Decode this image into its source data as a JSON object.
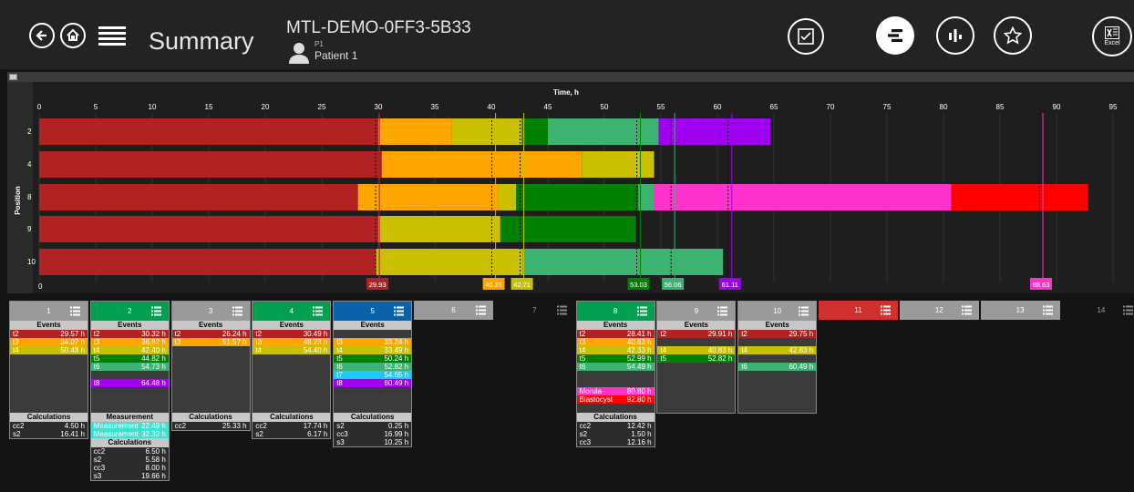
{
  "header": {
    "title": "Summary",
    "embryo_id": "MTL-DEMO-0FF3-5B33",
    "patient_code": "P1",
    "patient_name": "Patient 1",
    "excel_label": "Excel"
  },
  "icons": {
    "back": "back-arrow-icon",
    "home": "home-icon",
    "menu": "hamburger-menu-icon",
    "checklist": "checkbox-icon",
    "timeline": "timeline-bars-icon",
    "compare": "compare-chart-icon",
    "favorite": "star-icon",
    "excel": "excel-export-icon",
    "patient": "person-icon",
    "list": "list-icon"
  },
  "colors": {
    "t2": "#b22222",
    "t3": "#ffa500",
    "t4": "#c8c000",
    "t5": "#008000",
    "t6": "#3cb371",
    "t7": "#1ec8ff",
    "t8": "#a000f0",
    "morula": "#ff33cc",
    "blastocyst": "#ff0000",
    "measurement": "#40e0d0",
    "green_hdr": "#00a050",
    "blue_hdr": "#0a63a8",
    "red_hdr": "#d03030",
    "gray_hdr": "#9a9a9a"
  },
  "chart_data": {
    "type": "gantt",
    "xlabel": "Time, h",
    "ylabel": "Position",
    "xlim": [
      0,
      95
    ],
    "xticks": [
      0,
      5,
      10,
      15,
      20,
      25,
      30,
      35,
      40,
      45,
      50,
      55,
      60,
      65,
      70,
      75,
      80,
      85,
      90,
      95
    ],
    "rows": [
      {
        "position": "2",
        "segments": [
          [
            "t2",
            0,
            30
          ],
          [
            "t3",
            30,
            36.5
          ],
          [
            "t4",
            36.5,
            42.7
          ],
          [
            "t5",
            42.7,
            45
          ],
          [
            "t6",
            45,
            54.8
          ],
          [
            "t8",
            54.8,
            64.7
          ]
        ]
      },
      {
        "position": "4",
        "segments": [
          [
            "t2",
            0,
            30.3
          ],
          [
            "t3",
            30.3,
            48
          ],
          [
            "t4",
            48,
            54.4
          ]
        ]
      },
      {
        "position": "8",
        "segments": [
          [
            "t2",
            0,
            28.2
          ],
          [
            "t3",
            28.2,
            40.6
          ],
          [
            "t4",
            40.6,
            42.2
          ],
          [
            "t5",
            42.2,
            53
          ],
          [
            "t6",
            53,
            54.4
          ],
          [
            "morula",
            54.4,
            80.7
          ],
          [
            "blastocyst",
            80.7,
            92.8
          ]
        ]
      },
      {
        "position": "9",
        "segments": [
          [
            "t2",
            0,
            30
          ],
          [
            "t4",
            30,
            40.8
          ],
          [
            "t5",
            40.8,
            52.8
          ]
        ]
      },
      {
        "position": "10",
        "segments": [
          [
            "t2",
            0,
            29.8
          ],
          [
            "t4",
            29.8,
            42.8
          ],
          [
            "t6",
            42.8,
            60.5
          ]
        ]
      }
    ],
    "markers": [
      {
        "label": "29.93",
        "x": 29.93,
        "color": "#b22222"
      },
      {
        "label": "40.21",
        "x": 40.21,
        "color": "#ffa500"
      },
      {
        "label": "42.71",
        "x": 42.71,
        "color": "#c8c000"
      },
      {
        "label": "53.03",
        "x": 53.03,
        "color": "#008000"
      },
      {
        "label": "56.06",
        "x": 56.06,
        "color": "#3cb371"
      },
      {
        "label": "61.11",
        "x": 61.11,
        "color": "#a000f0"
      },
      {
        "label": "88.63",
        "x": 88.63,
        "color": "#ff33cc"
      }
    ]
  },
  "cards": [
    {
      "num": "1",
      "hdr": "gray_hdr",
      "events": [
        [
          "t2",
          "29.57 h",
          "t2"
        ],
        [
          "t3",
          "34.07 h",
          "t3"
        ],
        [
          "t4",
          "50.48 h",
          "t4"
        ]
      ],
      "calc_title": "Calculations",
      "calcs": [
        [
          "cc2",
          "4.50 h"
        ],
        [
          "s2",
          "16.41 h"
        ]
      ]
    },
    {
      "num": "2",
      "hdr": "green_hdr",
      "events": [
        [
          "t2",
          "30.32 h",
          "t2"
        ],
        [
          "t3",
          "36.82 h",
          "t3"
        ],
        [
          "t4",
          "42.40 h",
          "t4"
        ],
        [
          "t5",
          "44.82 h",
          "t5"
        ],
        [
          "t6",
          "54.73 h",
          "t6"
        ],
        [
          "",
          "",
          ""
        ],
        [
          "t8",
          "64.48 h",
          "t8"
        ]
      ],
      "meas_title": "Measurement",
      "meas": [
        [
          "Measurement",
          "22.49 h"
        ],
        [
          "Measurement",
          "32.32 h"
        ]
      ],
      "calc_title": "Calculations",
      "calcs": [
        [
          "cc2",
          "6.50 h"
        ],
        [
          "s2",
          "5.58 h"
        ],
        [
          "cc3",
          "8.00 h"
        ],
        [
          "s3",
          "19.66 h"
        ]
      ]
    },
    {
      "num": "3",
      "hdr": "gray_hdr",
      "events": [
        [
          "t2",
          "26.24 h",
          "t2"
        ],
        [
          "t3",
          "51.57 h",
          "t3"
        ]
      ],
      "calc_title": "Calculations",
      "calcs": [
        [
          "cc2",
          "25.33 h"
        ]
      ]
    },
    {
      "num": "4",
      "hdr": "green_hdr",
      "events": [
        [
          "t2",
          "30.49 h",
          "t2"
        ],
        [
          "t3",
          "48.23 h",
          "t3"
        ],
        [
          "t4",
          "54.40 h",
          "t4"
        ]
      ],
      "calc_title": "Calculations",
      "calcs": [
        [
          "cc2",
          "17.74 h"
        ],
        [
          "s2",
          "6.17 h"
        ]
      ]
    },
    {
      "num": "5",
      "hdr": "blue_hdr",
      "events": [
        [
          "",
          "",
          ""
        ],
        [
          "t3",
          "33.24 h",
          "t3"
        ],
        [
          "t4",
          "33.49 h",
          "t4"
        ],
        [
          "t5",
          "50.24 h",
          "t5"
        ],
        [
          "t6",
          "52.82 h",
          "t6"
        ],
        [
          "t7",
          "54.65 h",
          "t7"
        ],
        [
          "t8",
          "60.49 h",
          "t8"
        ]
      ],
      "calc_title": "Calculations",
      "calcs": [
        [
          "s2",
          "0.25 h"
        ],
        [
          "cc3",
          "16.99 h"
        ],
        [
          "s3",
          "10.25 h"
        ]
      ]
    },
    {
      "num": "6",
      "hdr": "gray_hdr",
      "plain": true
    },
    {
      "num": "7",
      "hdr": "dark",
      "plain": true
    },
    {
      "num": "8",
      "hdr": "green_hdr",
      "events": [
        [
          "t2",
          "28.41 h",
          "t2"
        ],
        [
          "t3",
          "40.63 h",
          "t3"
        ],
        [
          "t4",
          "42.33 h",
          "t4"
        ],
        [
          "t5",
          "52.99 h",
          "t5"
        ],
        [
          "t6",
          "54.49 h",
          "t6"
        ],
        [
          "",
          "",
          ""
        ],
        [
          "",
          "",
          ""
        ],
        [
          "Morula",
          "80.80 h",
          "morula"
        ],
        [
          "Blastocyst",
          "92.80 h",
          "blastocyst"
        ]
      ],
      "calc_title": "Calculations",
      "calcs": [
        [
          "cc2",
          "12.42 h"
        ],
        [
          "s2",
          "1.50 h"
        ],
        [
          "cc3",
          "12.16 h"
        ]
      ]
    },
    {
      "num": "9",
      "hdr": "gray_hdr",
      "events": [
        [
          "t2",
          "29.91 h",
          "t2"
        ],
        [
          "",
          "",
          ""
        ],
        [
          "t4",
          "40.83 h",
          "t4"
        ],
        [
          "t5",
          "52.82 h",
          "t5"
        ]
      ]
    },
    {
      "num": "10",
      "hdr": "gray_hdr",
      "events": [
        [
          "t2",
          "29.75 h",
          "t2"
        ],
        [
          "",
          "",
          ""
        ],
        [
          "t4",
          "42.83 h",
          "t4"
        ],
        [
          "",
          "",
          ""
        ],
        [
          "t6",
          "60.49 h",
          "t6"
        ]
      ]
    },
    {
      "num": "11",
      "hdr": "red_hdr",
      "plain": true
    },
    {
      "num": "12",
      "hdr": "gray_hdr",
      "plain": true
    },
    {
      "num": "13",
      "hdr": "gray_hdr",
      "plain": true
    },
    {
      "num": "14",
      "hdr": "dark",
      "plain": true
    }
  ],
  "labels": {
    "events": "Events"
  }
}
